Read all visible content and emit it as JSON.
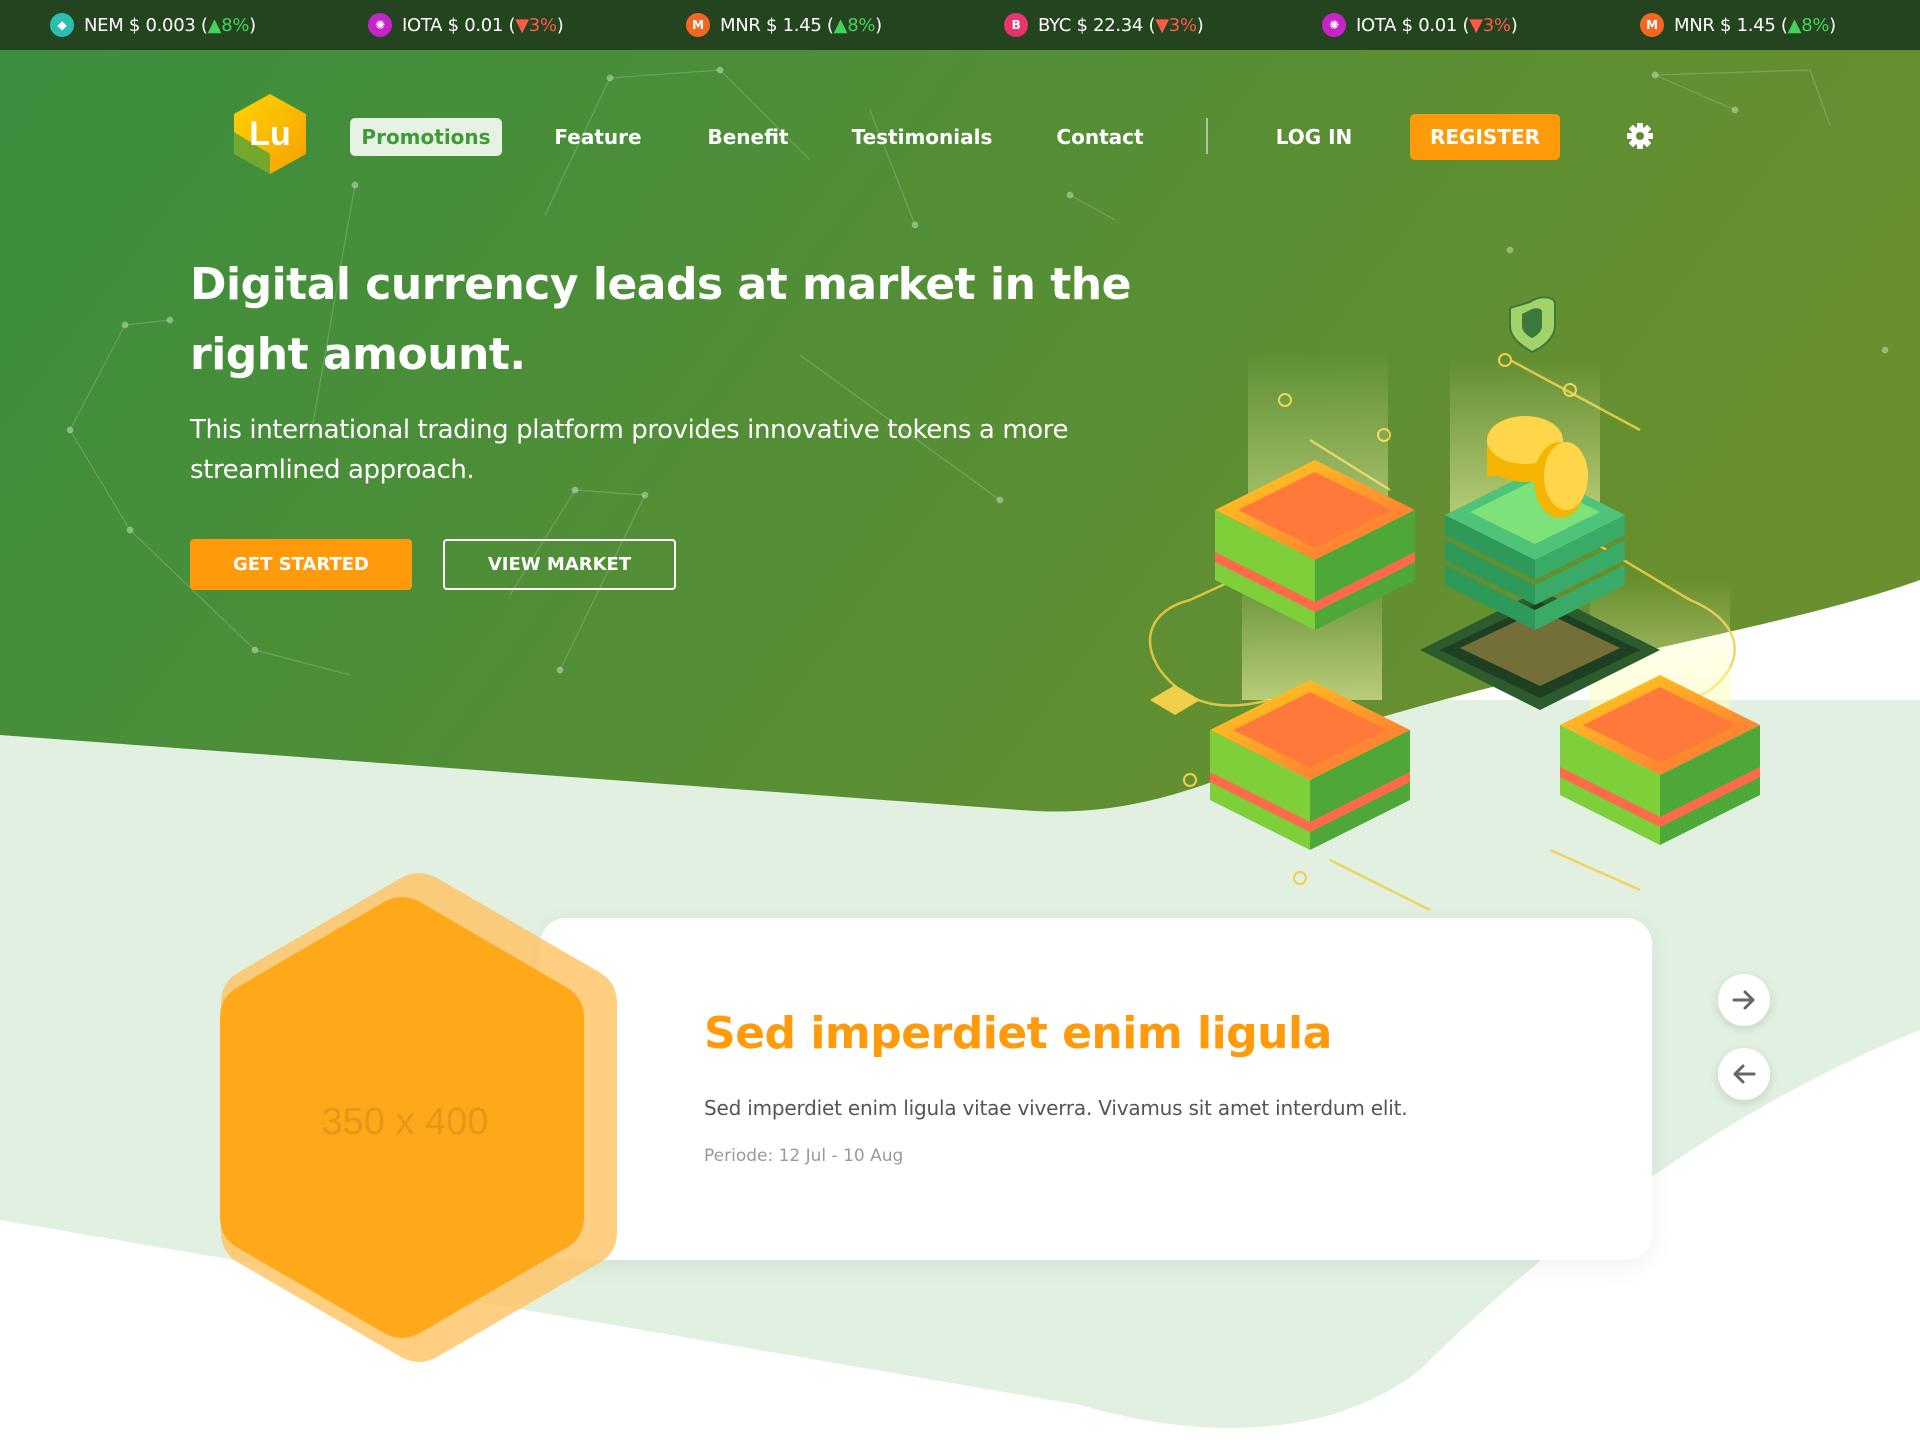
{
  "ticker": [
    {
      "symbol": "NEM",
      "price": "$ 0.003",
      "change": "8%",
      "direction": "up",
      "icon": "nem-coin-icon",
      "color": "#2cbfb0"
    },
    {
      "symbol": "IOTA",
      "price": "$ 0.01",
      "change": "3%",
      "direction": "down",
      "icon": "iota-coin-icon",
      "color": "#c524c9"
    },
    {
      "symbol": "MNR",
      "price": "$ 1.45",
      "change": "8%",
      "direction": "up",
      "icon": "monero-coin-icon",
      "color": "#f26822"
    },
    {
      "symbol": "BYC",
      "price": "$ 22.34",
      "change": "3%",
      "direction": "down",
      "icon": "bytecoin-coin-icon",
      "color": "#e8356b"
    },
    {
      "symbol": "IOTA",
      "price": "$ 0.01",
      "change": "3%",
      "direction": "down",
      "icon": "iota-coin-icon",
      "color": "#c524c9"
    },
    {
      "symbol": "MNR",
      "price": "$ 1.45",
      "change": "8%",
      "direction": "up",
      "icon": "monero-coin-icon",
      "color": "#f26822"
    }
  ],
  "logo": {
    "text": "Lu"
  },
  "nav": {
    "items": [
      "Promotions",
      "Feature",
      "Benefit",
      "Testimonials",
      "Contact"
    ],
    "active": "Promotions",
    "login": "LOG IN",
    "register": "REGISTER"
  },
  "hero": {
    "title_line1": "Digital currency leads at market in the",
    "title_line2": "right amount.",
    "subtitle_line1": "This international trading platform provides innovative tokens a more",
    "subtitle_line2": "streamlined approach.",
    "primary_button": "GET STARTED",
    "secondary_button": "VIEW MARKET"
  },
  "promo": {
    "image_placeholder": "350 x 400",
    "title": "Sed imperdiet enim ligula",
    "description": "Sed imperdiet enim ligula vitae viverra. Vivamus sit amet interdum elit.",
    "period": "Periode: 12 Jul - 10 Aug"
  },
  "colors": {
    "ticker_bg": "#24431f",
    "hero_green_start": "#3a8e3e",
    "hero_green_end": "#6a8f2e",
    "accent_orange": "#ff9b0a",
    "soft_green": "#e1f0e1"
  }
}
